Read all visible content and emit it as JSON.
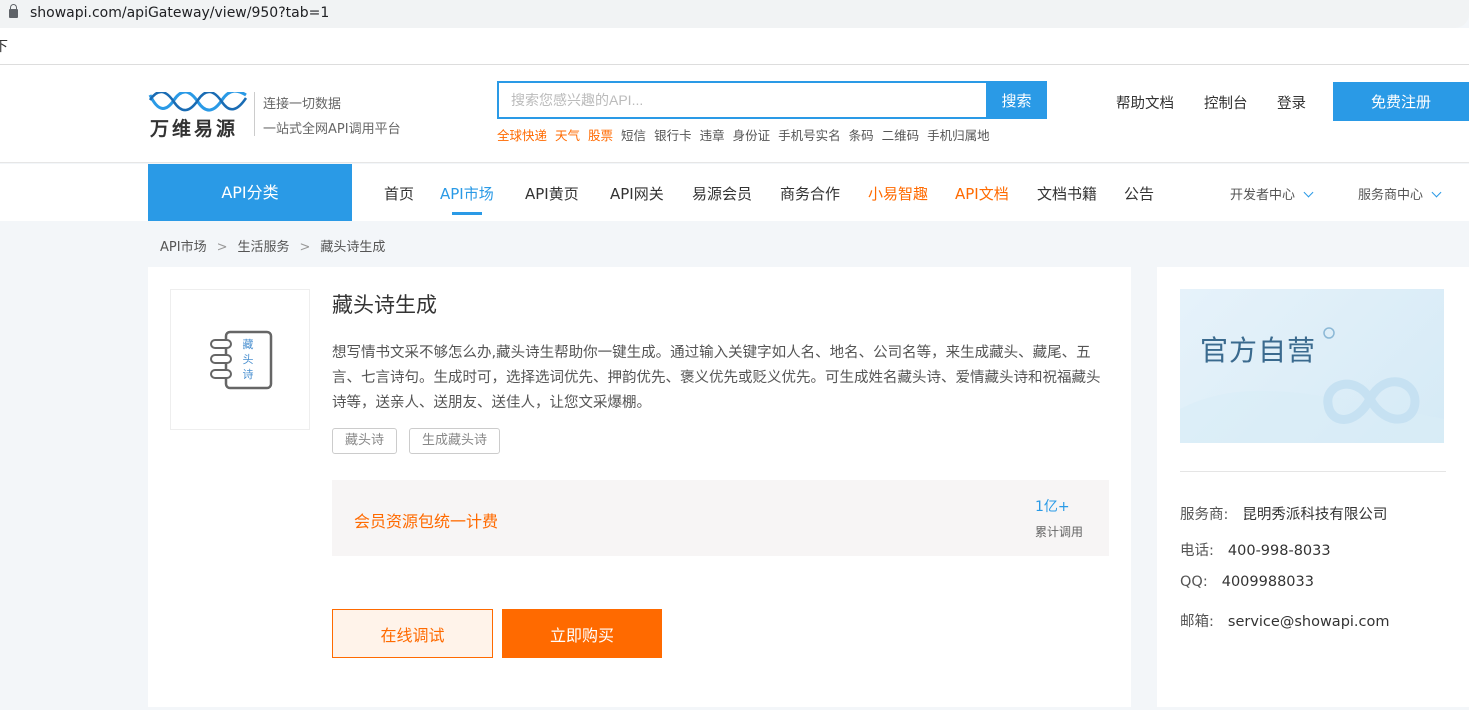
{
  "browser": {
    "url": "showapi.com/apiGateway/view/950?tab=1",
    "partial_glyph": "下"
  },
  "logo": {
    "name": "万维易源",
    "slogan1": "连接一切数据",
    "slogan2": "一站式全网API调用平台"
  },
  "search": {
    "placeholder": "搜索您感兴趣的API...",
    "button": "搜索"
  },
  "hot_keywords": [
    {
      "label": "全球快递",
      "highlight": true
    },
    {
      "label": "天气",
      "highlight": true
    },
    {
      "label": "股票",
      "highlight": true
    },
    {
      "label": "短信"
    },
    {
      "label": "银行卡"
    },
    {
      "label": "违章"
    },
    {
      "label": "身份证"
    },
    {
      "label": "手机号实名"
    },
    {
      "label": "条码"
    },
    {
      "label": "二维码"
    },
    {
      "label": "手机归属地"
    }
  ],
  "top_links": {
    "help": "帮助文档",
    "console": "控制台",
    "login": "登录",
    "register": "免费注册"
  },
  "nav": {
    "category": "API分类",
    "items": [
      "首页",
      "API市场",
      "API黄页",
      "API网关",
      "易源会员",
      "商务合作",
      "小易智趣",
      "API文档",
      "文档书籍",
      "公告"
    ],
    "dev_center": "开发者中心",
    "provider_center": "服务商中心"
  },
  "breadcrumb": [
    "API市场",
    "生活服务",
    "藏头诗生成"
  ],
  "breadcrumb_sep": ">",
  "product": {
    "icon_text": "藏头诗",
    "title": "藏头诗生成",
    "description": "想写情书文采不够怎么办,藏头诗生帮助你一键生成。通过输入关键字如人名、地名、公司名等，来生成藏头、藏尾、五言、七言诗句。生成时可，选择选词优先、押韵优先、褒义优先或贬义优先。可生成姓名藏头诗、爱情藏头诗和祝福藏头诗等，送亲人、送朋友、送佳人，让您文采爆棚。",
    "tags": [
      "藏头诗",
      "生成藏头诗"
    ],
    "price_label": "会员资源包统一计费",
    "calls": "1亿+",
    "calls_label": "累计调用",
    "try_button": "在线调试",
    "buy_button": "立即购买"
  },
  "provider": {
    "banner": "官方自营",
    "company_label": "服务商:",
    "company": "昆明秀派科技有限公司",
    "phone_label": "电话:",
    "phone": "400-998-8033",
    "qq_label": "QQ:",
    "qq": "4009988033",
    "email_label": "邮箱:",
    "email": "service@showapi.com"
  },
  "colors": {
    "accent": "#2a9ae6",
    "orange": "#ff6a00"
  }
}
